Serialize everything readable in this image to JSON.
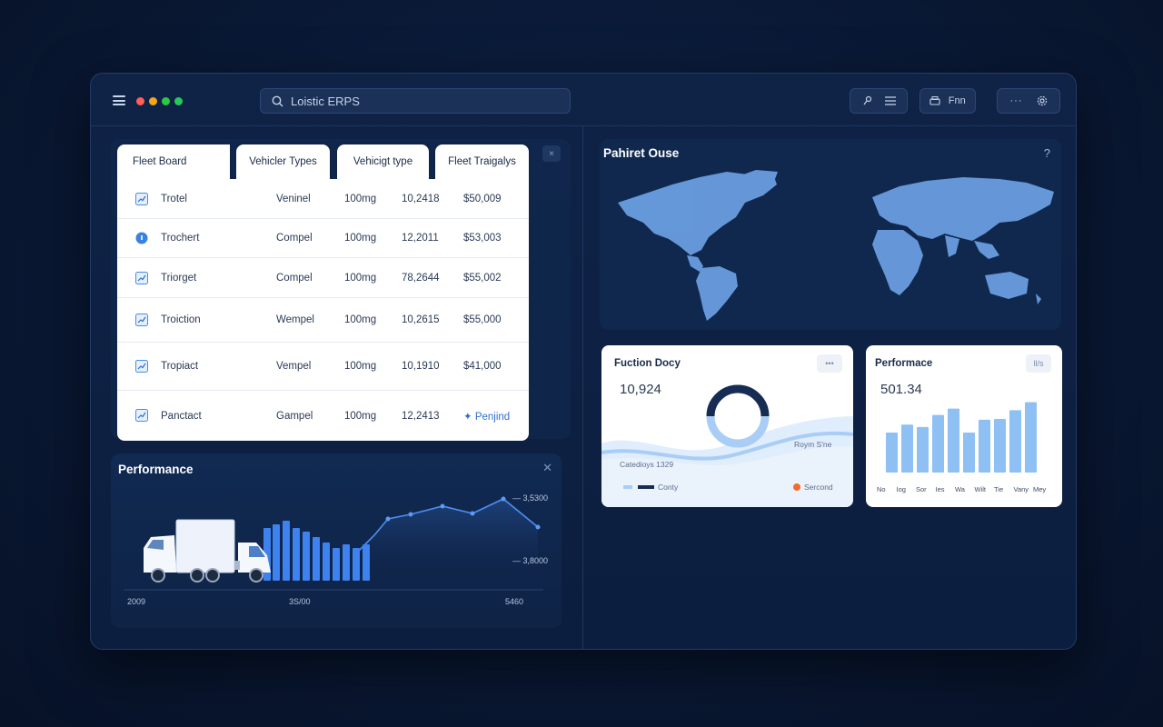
{
  "app": {
    "search_text": "Loistic ERPS",
    "toolbar_right_label": "Fnn",
    "traffic_colors": [
      "#ff5f57",
      "#f7a51c",
      "#2bc840",
      "#27c85a"
    ]
  },
  "fleet_table": {
    "tabs": [
      "Fleet Board",
      "Vehicler Types",
      "Vehicigt type",
      "Fleet Traigalys"
    ],
    "rows": [
      {
        "icon": "chart-icon",
        "name": "Trotel",
        "type": "Veninel",
        "qty": "100mg",
        "id": "10,2418",
        "amount": "$50,009"
      },
      {
        "icon": "info-circle-icon",
        "name": "Trochert",
        "type": "Compel",
        "qty": "100mg",
        "id": "12,2011",
        "amount": "$53,003"
      },
      {
        "icon": "chart-icon",
        "name": "Triorget",
        "type": "Compel",
        "qty": "100mg",
        "id": "78,2644",
        "amount": "$55,002"
      },
      {
        "icon": "chart-icon",
        "name": "Troiction",
        "type": "Wempel",
        "qty": "100mg",
        "id": "10,2615",
        "amount": "$55,000"
      },
      {
        "icon": "chart-icon",
        "name": "Tropiact",
        "type": "Vempel",
        "qty": "100mg",
        "id": "10,1910",
        "amount": "$41,000"
      },
      {
        "icon": "chart-icon",
        "name": "Panctact",
        "type": "Gampel",
        "qty": "100mg",
        "id": "12,2413",
        "amount": "Penjind"
      }
    ]
  },
  "performance_left": {
    "title": "Performance",
    "y_labels": [
      "— 3,5300",
      "— 3,8000"
    ],
    "x_labels": [
      "2009",
      "3S/00",
      "5460"
    ]
  },
  "map": {
    "title": "Pahiret Ouse",
    "help": "?"
  },
  "fuction_card": {
    "title": "Fuction Docy",
    "value": "10,924",
    "btn": "•••",
    "wave_label": "Roym S'ne",
    "footer_label": "Catedioys 1329",
    "legend_left": "Conty",
    "legend_right": "Sercond",
    "accent_orange": "#f06b2f"
  },
  "performance_right": {
    "title": "Performace",
    "value": "501.34",
    "btn": "ll/s",
    "chart_data": {
      "type": "bar",
      "categories": [
        "No",
        "Iog",
        "Sor",
        "Ies",
        "Wa",
        "Wilt",
        "Tie",
        "Vany",
        "Mey"
      ],
      "values": [
        50,
        60,
        57,
        72,
        80,
        50,
        66,
        67,
        78,
        88
      ],
      "ylim": [
        0,
        100
      ]
    }
  }
}
